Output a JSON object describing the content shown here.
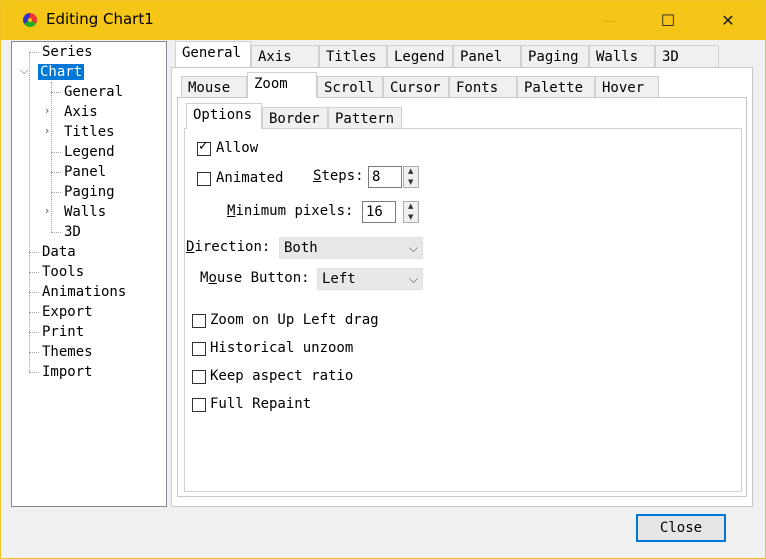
{
  "window": {
    "title": "Editing Chart1",
    "close_symbol": "✕",
    "max_symbol": "☐",
    "min_symbol": "—"
  },
  "tree": {
    "items": [
      {
        "label": "Series"
      },
      {
        "label": "Chart",
        "expanded": true,
        "selected": true
      },
      {
        "label": "General"
      },
      {
        "label": "Axis",
        "collapsed": true
      },
      {
        "label": "Titles",
        "collapsed": true
      },
      {
        "label": "Legend"
      },
      {
        "label": "Panel"
      },
      {
        "label": "Paging"
      },
      {
        "label": "Walls",
        "collapsed": true
      },
      {
        "label": "3D"
      },
      {
        "label": "Data"
      },
      {
        "label": "Tools"
      },
      {
        "label": "Animations"
      },
      {
        "label": "Export"
      },
      {
        "label": "Print"
      },
      {
        "label": "Themes"
      },
      {
        "label": "Import"
      }
    ]
  },
  "top_tabs": [
    "General",
    "Axis",
    "Titles",
    "Legend",
    "Panel",
    "Paging",
    "Walls",
    "3D"
  ],
  "sub_tabs": [
    "Mouse",
    "Zoom",
    "Scroll",
    "Cursor",
    "Fonts",
    "Palette",
    "Hover"
  ],
  "option_tabs": [
    "Options",
    "Border",
    "Pattern"
  ],
  "zoom": {
    "allow_label": "Allow",
    "allow_checked": true,
    "animated_label": "Animated",
    "animated_checked": false,
    "steps_label": "Steps:",
    "steps_value": "8",
    "min_pixels_label": "Minimum pixels:",
    "min_pixels_value": "16",
    "direction_label": "Direction:",
    "direction_value": "Both",
    "mouse_button_label": "Mouse Button:",
    "mouse_button_value": "Left",
    "checkboxes": [
      {
        "label": "Zoom on Up Left drag",
        "checked": false
      },
      {
        "label": "Historical unzoom",
        "checked": false
      },
      {
        "label": "Keep aspect ratio",
        "checked": false
      },
      {
        "label": "Full Repaint",
        "checked": false
      }
    ]
  },
  "footer": {
    "close_label": "Close"
  },
  "colors": {
    "titlebar": "#f5c518",
    "selection": "#0078d7"
  }
}
